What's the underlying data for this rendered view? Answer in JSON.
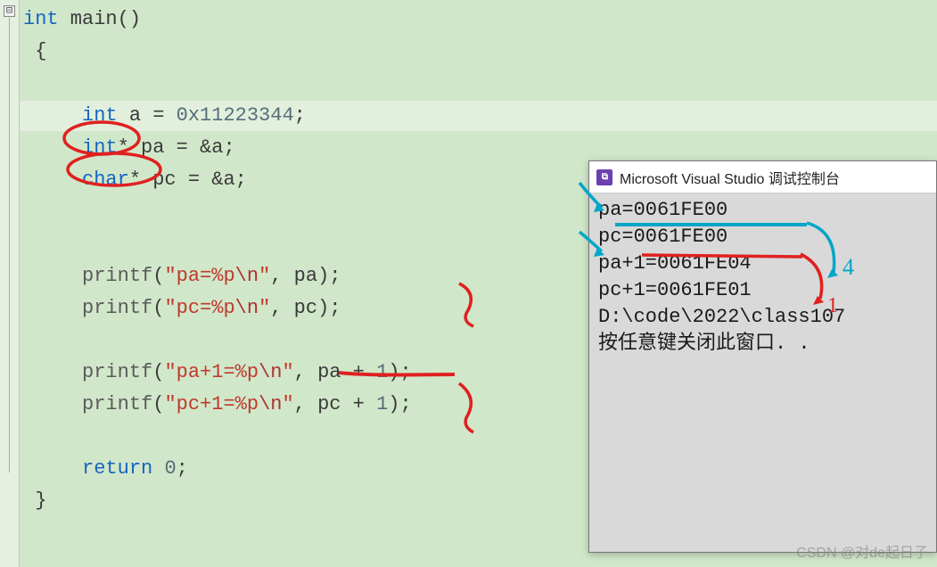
{
  "code": {
    "tokens": [
      {
        "t": "kw",
        "v": "int"
      },
      {
        "t": "pln",
        "v": " main()"
      },
      {
        "t": "nl"
      },
      {
        "t": "pln",
        "v": "{"
      },
      {
        "t": "nl"
      },
      {
        "t": "nl"
      },
      {
        "t": "pln",
        "v": "    "
      },
      {
        "t": "kw",
        "v": "int"
      },
      {
        "t": "pln",
        "v": " a = "
      },
      {
        "t": "num",
        "v": "0x11223344"
      },
      {
        "t": "pln",
        "v": ";"
      },
      {
        "t": "nl"
      },
      {
        "t": "pln",
        "v": "    "
      },
      {
        "t": "kw",
        "v": "int"
      },
      {
        "t": "op",
        "v": "*"
      },
      {
        "t": "pln",
        "v": " pa = &a;"
      },
      {
        "t": "nl"
      },
      {
        "t": "pln",
        "v": "    "
      },
      {
        "t": "kw",
        "v": "char"
      },
      {
        "t": "op",
        "v": "*"
      },
      {
        "t": "pln",
        "v": " pc = &a;"
      },
      {
        "t": "nl"
      },
      {
        "t": "nl"
      },
      {
        "t": "nl"
      },
      {
        "t": "pln",
        "v": "    "
      },
      {
        "t": "fn",
        "v": "printf"
      },
      {
        "t": "pln",
        "v": "("
      },
      {
        "t": "str",
        "v": "\"pa=%p"
      },
      {
        "t": "esc",
        "v": "\\n"
      },
      {
        "t": "str",
        "v": "\""
      },
      {
        "t": "pln",
        "v": ", pa);"
      },
      {
        "t": "nl"
      },
      {
        "t": "pln",
        "v": "    "
      },
      {
        "t": "fn",
        "v": "printf"
      },
      {
        "t": "pln",
        "v": "("
      },
      {
        "t": "str",
        "v": "\"pc=%p"
      },
      {
        "t": "esc",
        "v": "\\n"
      },
      {
        "t": "str",
        "v": "\""
      },
      {
        "t": "pln",
        "v": ", pc);"
      },
      {
        "t": "nl"
      },
      {
        "t": "nl"
      },
      {
        "t": "pln",
        "v": "    "
      },
      {
        "t": "fn",
        "v": "printf"
      },
      {
        "t": "pln",
        "v": "("
      },
      {
        "t": "str",
        "v": "\"pa+1=%p"
      },
      {
        "t": "esc",
        "v": "\\n"
      },
      {
        "t": "str",
        "v": "\""
      },
      {
        "t": "pln",
        "v": ", pa + "
      },
      {
        "t": "num",
        "v": "1"
      },
      {
        "t": "pln",
        "v": ");"
      },
      {
        "t": "nl"
      },
      {
        "t": "pln",
        "v": "    "
      },
      {
        "t": "fn",
        "v": "printf"
      },
      {
        "t": "pln",
        "v": "("
      },
      {
        "t": "str",
        "v": "\"pc+1=%p"
      },
      {
        "t": "esc",
        "v": "\\n"
      },
      {
        "t": "str",
        "v": "\""
      },
      {
        "t": "pln",
        "v": ", pc + "
      },
      {
        "t": "num",
        "v": "1"
      },
      {
        "t": "pln",
        "v": ");"
      },
      {
        "t": "nl"
      },
      {
        "t": "nl"
      },
      {
        "t": "pln",
        "v": "    "
      },
      {
        "t": "kw",
        "v": "return"
      },
      {
        "t": "pln",
        "v": " "
      },
      {
        "t": "num",
        "v": "0"
      },
      {
        "t": "pln",
        "v": ";"
      },
      {
        "t": "nl"
      },
      {
        "t": "pln",
        "v": "}"
      }
    ]
  },
  "fold_glyph": "⊟",
  "console": {
    "title": "Microsoft Visual Studio 调试控制台",
    "icon_text": "⧉",
    "lines": [
      "pa=0061FE00",
      "pc=0061FE00",
      "pa+1=0061FE04",
      "pc+1=0061FE01",
      "",
      "D:\\code\\2022\\class107",
      "按任意键关闭此窗口. ."
    ]
  },
  "watermark": "CSDN @对de起日子",
  "colors": {
    "editor_bg": "#d1e7ca",
    "keyword": "#1565c0",
    "string": "#c0392b",
    "red_pen": "#e02020",
    "blue_pen": "#00a6c8"
  },
  "annotations": {
    "red_circles": [
      "int*",
      "char*"
    ],
    "red_underline_target": "pc + 1",
    "blue_underline_target": "pa=0061FE00"
  }
}
